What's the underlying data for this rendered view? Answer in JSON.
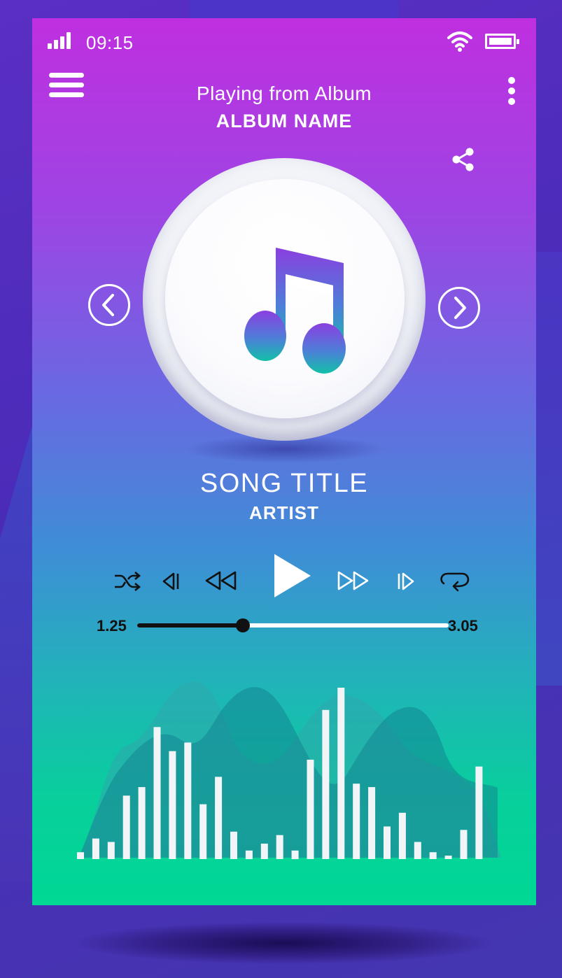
{
  "status_bar": {
    "time": "09:15",
    "signal_icon": "signal-bars-icon",
    "wifi_icon": "wifi-icon",
    "battery_icon": "battery-full-icon"
  },
  "header": {
    "menu_icon": "hamburger-menu-icon",
    "playing_from": "Playing from Album",
    "album_name": "ALBUM NAME",
    "more_icon": "more-vertical-icon",
    "share_icon": "share-icon"
  },
  "artwork": {
    "icon": "music-note-icon",
    "prev_icon": "chevron-left-icon",
    "next_icon": "chevron-right-icon"
  },
  "track": {
    "title": "SONG TITLE",
    "artist": "ARTIST"
  },
  "controls": {
    "shuffle_icon": "shuffle-icon",
    "previous_icon": "skip-previous-icon",
    "rewind_icon": "rewind-icon",
    "play_icon": "play-icon",
    "fast_forward_icon": "fast-forward-icon",
    "next_icon": "skip-next-icon",
    "repeat_icon": "repeat-icon"
  },
  "progress": {
    "elapsed": "1.25",
    "total": "3.05",
    "fraction": 0.34
  },
  "visualizer": {
    "bar_levels": [
      0.04,
      0.12,
      0.1,
      0.37,
      0.42,
      0.77,
      0.63,
      0.68,
      0.32,
      0.48,
      0.16,
      0.05,
      0.09,
      0.14,
      0.05,
      0.58,
      0.87,
      1.0,
      0.44,
      0.42,
      0.19,
      0.27,
      0.1,
      0.04,
      0.02,
      0.17,
      0.54
    ],
    "colors": {
      "bar": "#f2f5f7",
      "wave_light": "#2fa7ad",
      "wave_dark": "#12808f"
    }
  },
  "colors": {
    "gradient_top": "#bf2fe0",
    "gradient_mid": "#6a68e2",
    "gradient_bottom": "#00d894",
    "note_top": "#8a3fe0",
    "note_bottom": "#12c0a8"
  }
}
